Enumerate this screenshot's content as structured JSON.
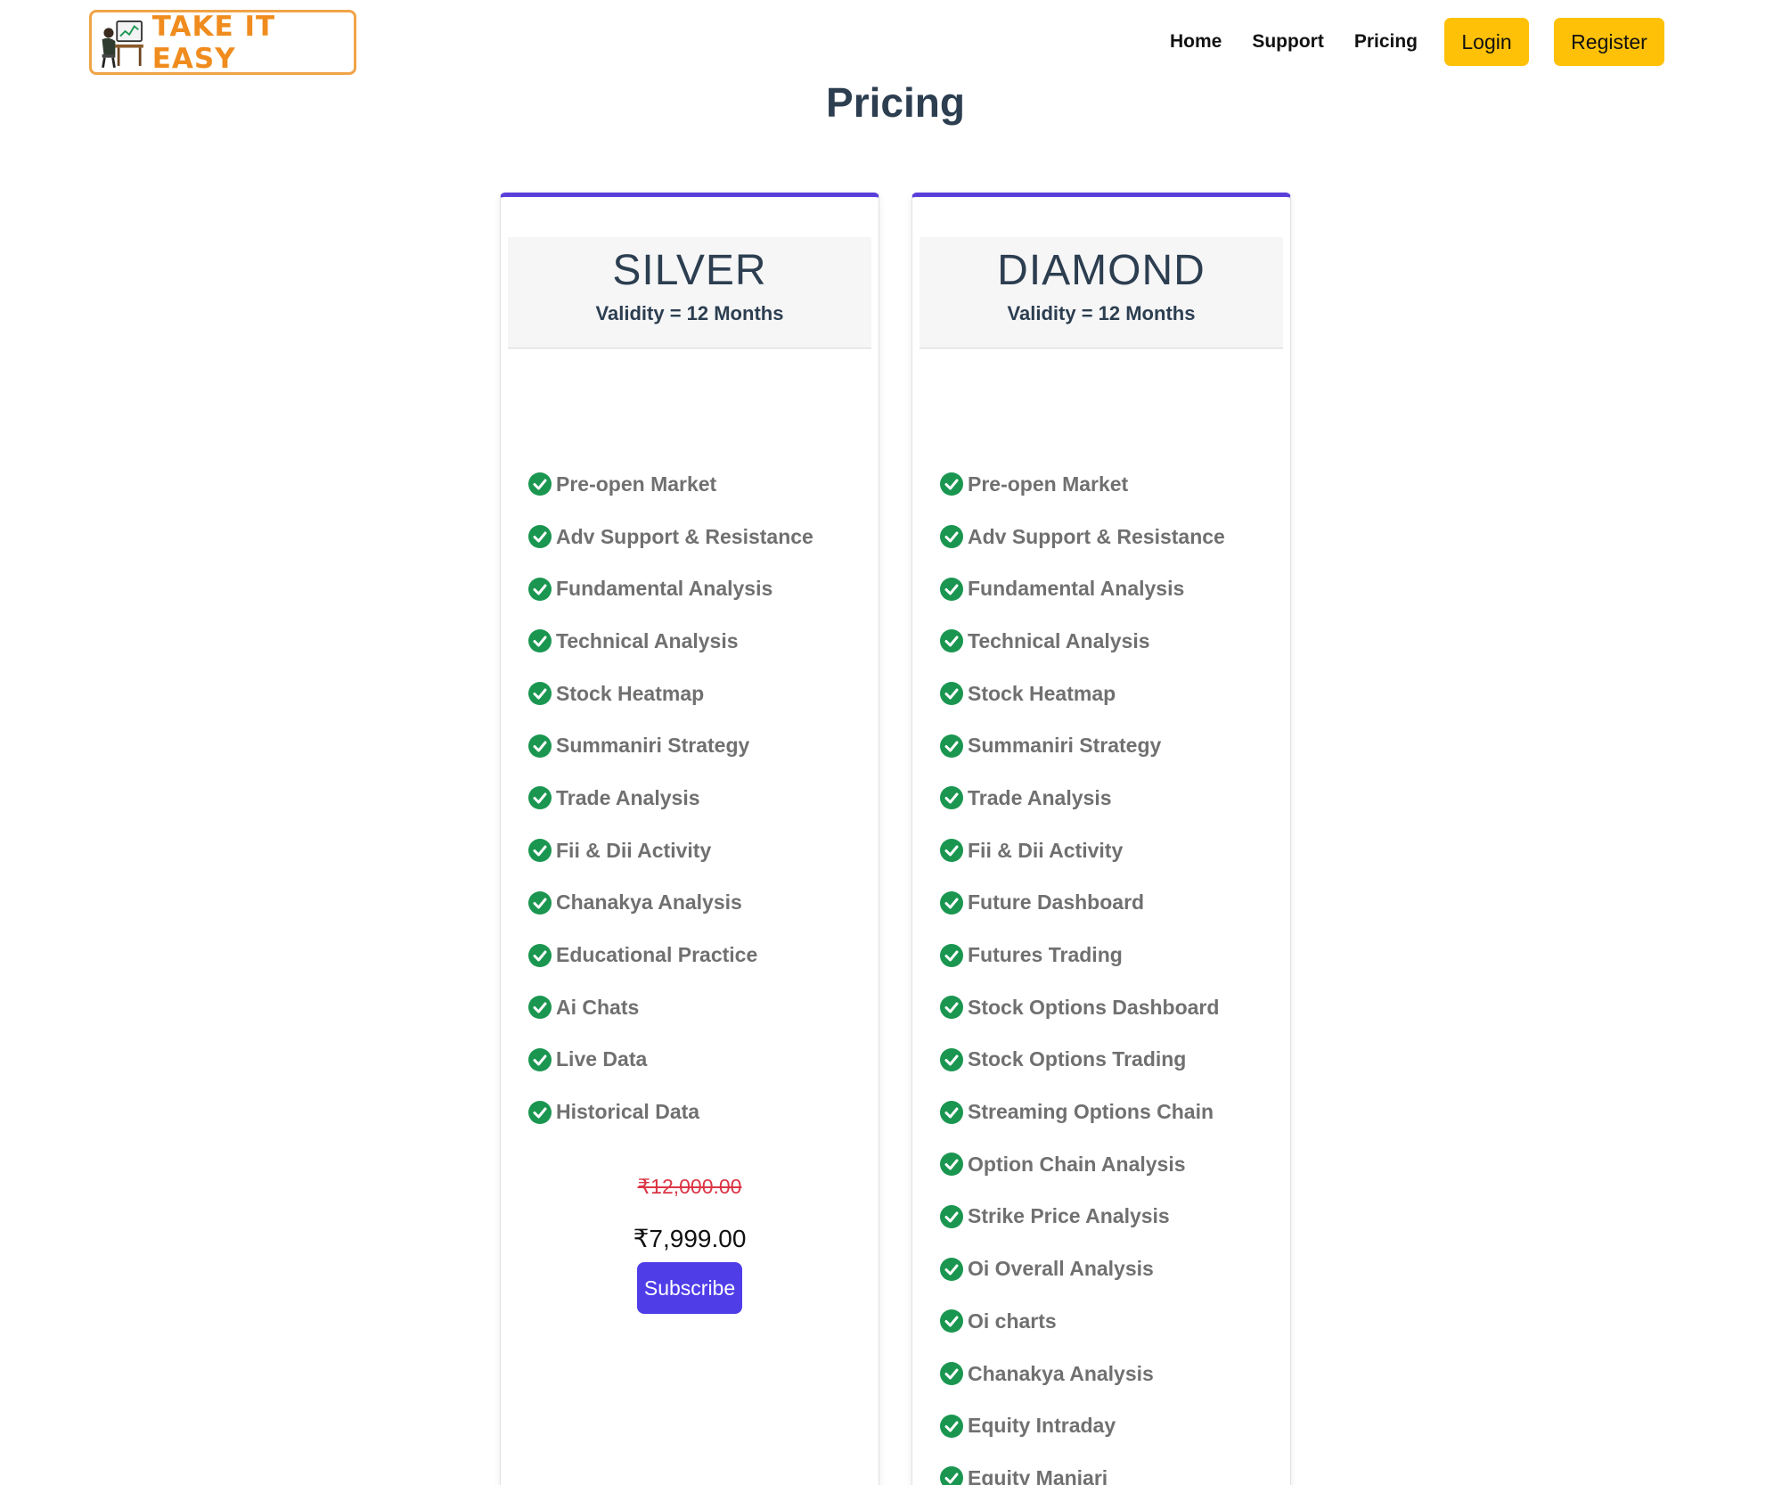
{
  "brand": {
    "name": "TAKE IT EASY"
  },
  "nav": {
    "home": "Home",
    "support": "Support",
    "pricing": "Pricing",
    "login": "Login",
    "register": "Register"
  },
  "page": {
    "title": "Pricing"
  },
  "plans": [
    {
      "name": "SILVER",
      "validity": "Validity = 12 Months",
      "features": [
        "Pre-open Market",
        "Adv Support & Resistance",
        "Fundamental Analysis",
        "Technical Analysis",
        "Stock Heatmap",
        "Summaniri Strategy",
        "Trade Analysis",
        "Fii & Dii Activity",
        "Chanakya Analysis",
        "Educational Practice",
        "Ai Chats",
        "Live Data",
        "Historical Data"
      ],
      "old_price": "₹12,000.00",
      "price": "₹7,999.00",
      "cta": "Subscribe"
    },
    {
      "name": "DIAMOND",
      "validity": "Validity = 12 Months",
      "features": [
        "Pre-open Market",
        "Adv Support & Resistance",
        "Fundamental Analysis",
        "Technical Analysis",
        "Stock Heatmap",
        "Summaniri Strategy",
        "Trade Analysis",
        "Fii & Dii Activity",
        "Future Dashboard",
        "Futures Trading",
        "Stock Options Dashboard",
        "Stock Options Trading",
        "Streaming Options Chain",
        "Option Chain Analysis",
        "Strike Price Analysis",
        "Oi Overall Analysis",
        "Oi charts",
        "Chanakya Analysis",
        "Equity Intraday",
        "Equity Manjari"
      ]
    }
  ],
  "colors": {
    "accent": "#5b3fdb",
    "button": "#4f3de8",
    "nav_button": "#ffc107",
    "check": "#1a9650",
    "strike": "#dc3545",
    "logo": "#f08c1e"
  },
  "icons": {
    "feature": "check-circle-icon",
    "logo": "trader-at-desk-icon"
  }
}
